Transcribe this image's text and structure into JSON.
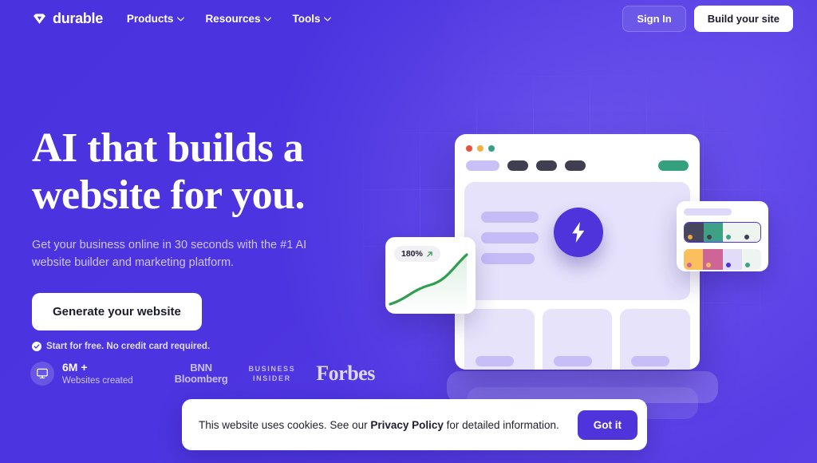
{
  "nav": {
    "logo_icon": "diamond-gem-icon",
    "logo_text": "durable",
    "links": [
      {
        "label": "Products",
        "icon": "chevron-down-icon"
      },
      {
        "label": "Resources",
        "icon": "chevron-down-icon"
      },
      {
        "label": "Tools",
        "icon": "chevron-down-icon"
      }
    ],
    "sign_in_label": "Sign In",
    "build_site_label": "Build your site"
  },
  "hero": {
    "headline_line1": "AI that builds a",
    "headline_line2": "website for you.",
    "subhead": "Get your business online in 30 seconds with the #1 AI website builder and marketing platform.",
    "cta_label": "Generate your website",
    "free_note": "Start for free. No credit card required.",
    "free_note_icon": "check-circle-icon"
  },
  "proof": {
    "icon": "monitor-icon",
    "stat_number": "6M +",
    "stat_label": "Websites created",
    "logos": [
      {
        "name": "bnn-bloomberg-logo",
        "line1": "BNN",
        "line2": "Bloomberg"
      },
      {
        "name": "business-insider-logo",
        "line1": "BUSINESS",
        "line2": "INSIDER"
      },
      {
        "name": "forbes-logo",
        "line1": "Forbes"
      }
    ]
  },
  "illustration": {
    "browser": {
      "dots": [
        "#e4513c",
        "#efb141",
        "#349f84"
      ],
      "nav_pill_color": "#c8c0f7",
      "menu_pill_color": "#3f3f51",
      "cta_pill_color": "#34a07f",
      "bolt_icon": "lightning-bolt-icon",
      "bolt_circle_color": "#5034db"
    },
    "chart_card": {
      "badge_value": "180%",
      "badge_icon": "arrow-up-right-icon",
      "line_color": "#2f9e52"
    },
    "palette_card": {
      "row_selected": [
        "#46465c",
        "#3da186",
        "#eef4f0",
        "#eef4f0"
      ],
      "row_selected_dots": [
        "#f0a73c",
        "#3f3f51",
        "#3da186",
        "#3f3f51"
      ],
      "row_two": [
        "#fbbf5e",
        "#cf6596",
        "#e2dcf8",
        "#eef4f0"
      ],
      "row_two_dots": [
        "#cf6596",
        "#fbbf5e",
        "#4a33de",
        "#3da186"
      ]
    }
  },
  "cookie": {
    "text_before": "This website uses cookies. See our ",
    "link_label": "Privacy Policy",
    "text_after": " for detailed information.",
    "accept_label": "Got it"
  },
  "colors": {
    "brand_purple": "#4a33de",
    "accent_purple": "#5034db",
    "white": "#ffffff"
  }
}
